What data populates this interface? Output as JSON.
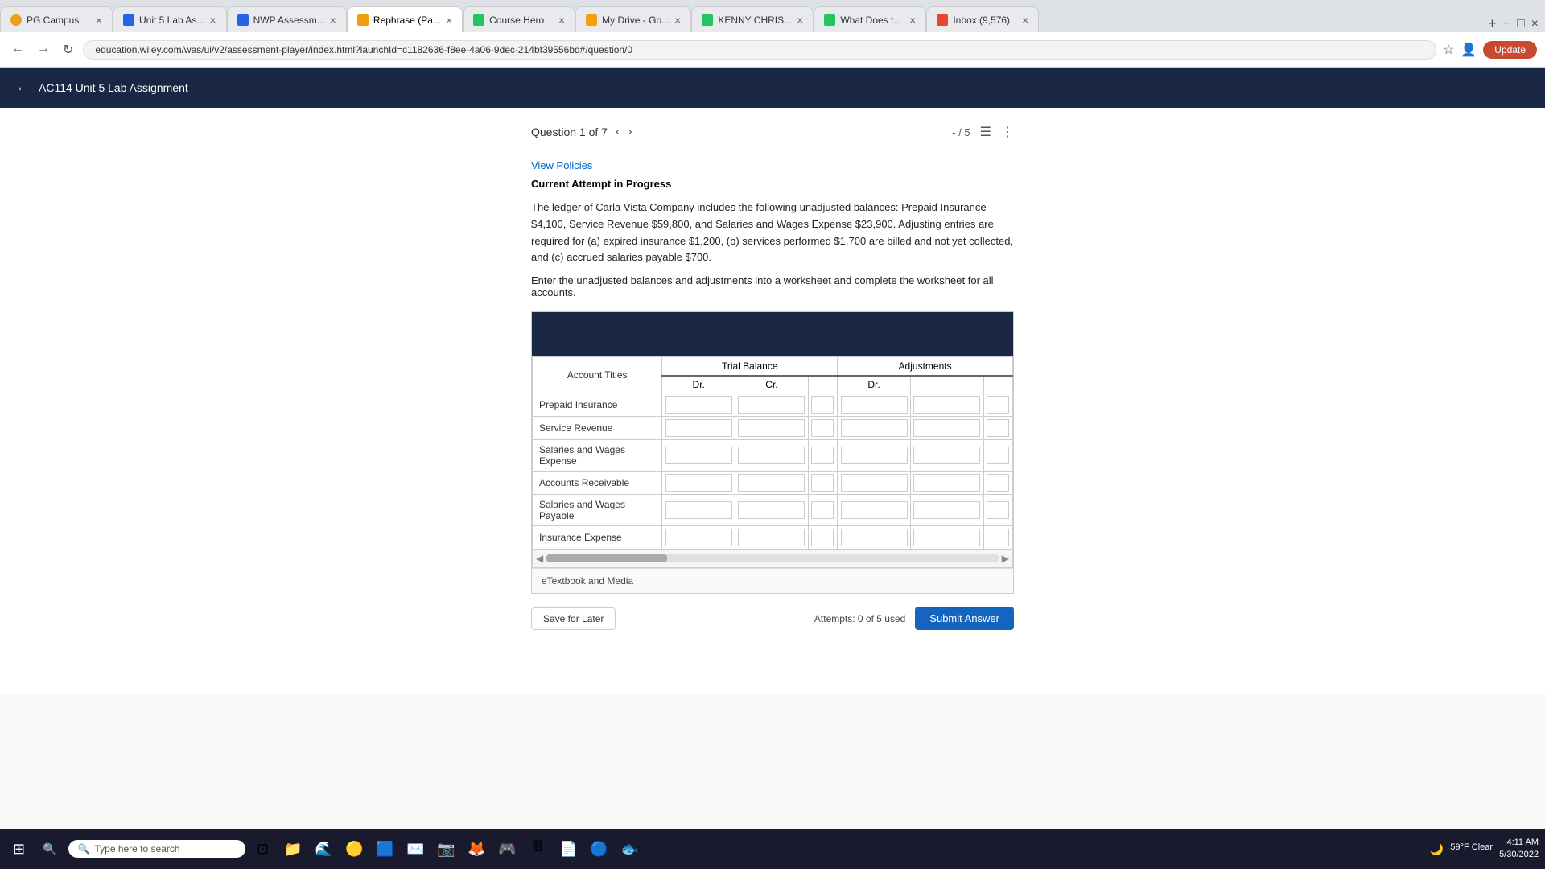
{
  "browser": {
    "tabs": [
      {
        "id": "pg-campus",
        "label": "PG Campus",
        "favicon_color": "#e8a020",
        "active": false
      },
      {
        "id": "unit5-lab",
        "label": "Unit 5 Lab As...",
        "favicon_color": "#2563eb",
        "active": false
      },
      {
        "id": "nwp-assess",
        "label": "NWP Assessm...",
        "favicon_color": "#2563eb",
        "active": false
      },
      {
        "id": "rephrase",
        "label": "Rephrase (Pa...",
        "favicon_color": "#f59e0b",
        "active": true
      },
      {
        "id": "course-hero",
        "label": "Course Hero",
        "favicon_color": "#22c55e",
        "active": false
      },
      {
        "id": "my-drive",
        "label": "My Drive - Go...",
        "favicon_color": "#f59e0b",
        "active": false
      },
      {
        "id": "kenny-chris",
        "label": "KENNY CHRIS...",
        "favicon_color": "#22c55e",
        "active": false
      },
      {
        "id": "what-does",
        "label": "What Does t...",
        "favicon_color": "#22c55e",
        "active": false
      },
      {
        "id": "gmail",
        "label": "Inbox (9,576)",
        "favicon_color": "#ea4335",
        "active": false
      }
    ],
    "url": "education.wiley.com/was/ui/v2/assessment-player/index.html?launchId=c1182636-f8ee-4a06-9dec-214bf39556bd#/question/0",
    "update_label": "Update"
  },
  "app": {
    "title": "AC114 Unit 5 Lab Assignment",
    "back_label": "←"
  },
  "question": {
    "label": "Question 1 of 7",
    "number": "1",
    "total": "7",
    "score_display": "- / 5",
    "view_policies": "View Policies",
    "attempt_status": "Current Attempt in Progress",
    "problem_text": "The ledger of Carla Vista Company includes the following unadjusted balances: Prepaid Insurance $4,100, Service Revenue $59,800, and Salaries and Wages Expense $23,900. Adjusting entries are required for (a) expired insurance $1,200, (b) services performed $1,700 are billed and not yet collected, and (c) accrued salaries payable $700.",
    "instruction_text": "Enter the unadjusted balances and adjustments into a worksheet and complete the worksheet for all accounts.",
    "table": {
      "header_trial_balance": "Trial Balance",
      "header_adjustments": "Adjustments",
      "col_account": "Account Titles",
      "col_dr": "Dr.",
      "col_cr": "Cr.",
      "rows": [
        {
          "id": "prepaid-insurance",
          "label": "Prepaid Insurance"
        },
        {
          "id": "service-revenue",
          "label": "Service Revenue"
        },
        {
          "id": "salaries-wages-expense",
          "label": "Salaries and Wages Expense"
        },
        {
          "id": "accounts-receivable",
          "label": "Accounts Receivable"
        },
        {
          "id": "salaries-wages-payable",
          "label": "Salaries and Wages Payable"
        },
        {
          "id": "insurance-expense",
          "label": "Insurance Expense"
        }
      ]
    },
    "footer_label": "eTextbook and Media",
    "save_label": "Save for Later",
    "attempts_text": "Attempts: 0 of 5 used",
    "submit_label": "Submit Answer"
  },
  "taskbar": {
    "search_placeholder": "Type here to search",
    "weather": "59°F  Clear",
    "time": "4:11 AM",
    "date": "5/30/2022"
  }
}
